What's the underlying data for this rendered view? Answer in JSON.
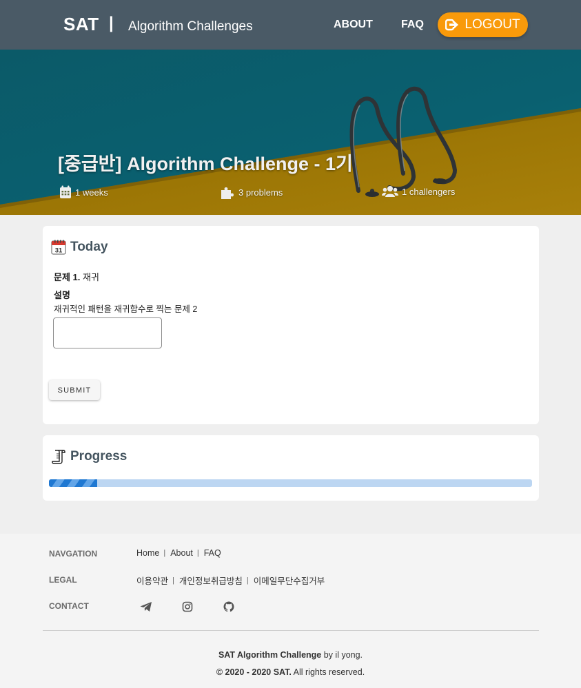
{
  "header": {
    "brand": "SAT",
    "separator": "|",
    "subtitle": "Algorithm Challenges",
    "nav": {
      "about": "ABOUT",
      "faq": "FAQ"
    },
    "logout_label": "LOGOUT",
    "logout_color": "#f99a0a",
    "background_color": "#4a5a66"
  },
  "hero": {
    "title": "[중급반] Algorithm Challenge - 1기",
    "stats": {
      "weeks": "1 weeks",
      "problems": "3 problems",
      "challengers": "1 challengers"
    },
    "stat_icons": [
      "calendar-icon",
      "puzzle-icon",
      "users-icon"
    ]
  },
  "today": {
    "heading": "Today",
    "heading_icon": "calendar-emoji-icon",
    "problem_prefix": "문제 1.",
    "problem_name": "재귀",
    "description_label": "설명",
    "description_text": "재귀적인 패턴을 재귀함수로 찍는 문제 2",
    "answer_value": "",
    "submit_label": "SUBMIT"
  },
  "progress": {
    "heading": "Progress",
    "heading_icon": "scroll-icon",
    "fraction": 0.1,
    "fill_color": "#1f78d2",
    "track_color": "#bcd6f2"
  },
  "footer": {
    "navigation_label": "NAVGATION",
    "navigation_links": [
      "Home",
      "About",
      "FAQ"
    ],
    "legal_label": "LEGAL",
    "legal_links": [
      "이용약관",
      "개인정보취급방침",
      "이메일무단수집거부"
    ],
    "contact_label": "CONTACT",
    "contact_icons": [
      "telegram-icon",
      "instagram-icon",
      "github-icon"
    ],
    "credit_bold": "SAT Algorithm Challenge",
    "credit_rest": " by il yong.",
    "copyright_bold": "© 2020 - 2020 SAT.",
    "copyright_rest": " All rights reserved."
  }
}
